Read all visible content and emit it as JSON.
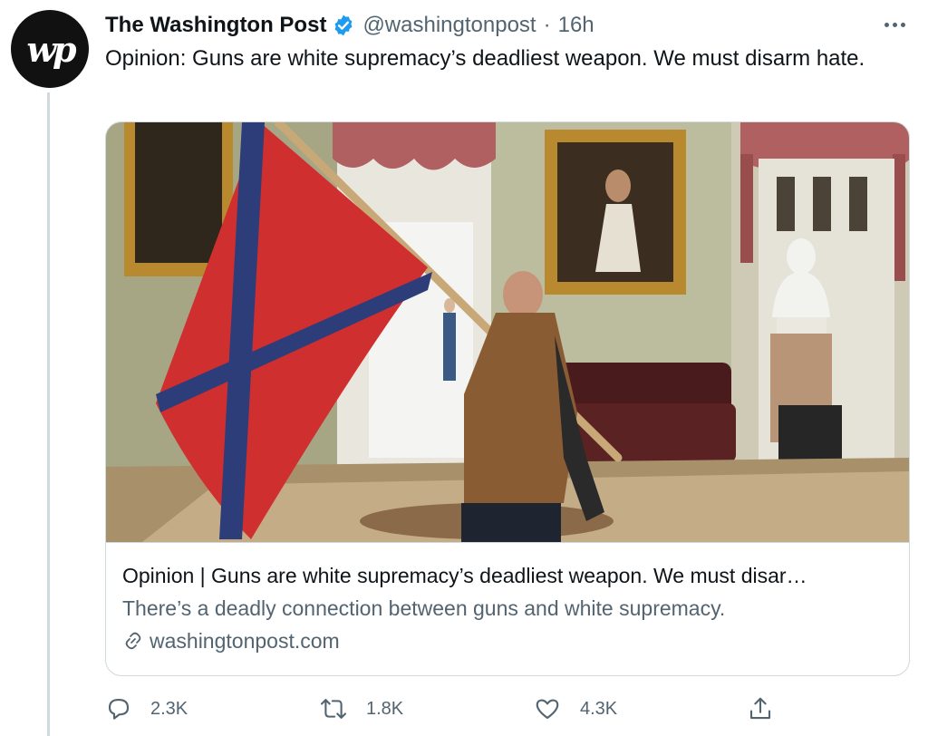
{
  "author": {
    "display_name": "The Washington Post",
    "handle": "@washingtonpost",
    "separator": "·",
    "time": "16h",
    "avatar_text": "wp",
    "verified_color": "#1d9bf0"
  },
  "tweet": {
    "text": "Opinion: Guns are white supremacy’s deadliest weapon. We must disarm hate."
  },
  "card": {
    "title": "Opinion | Guns are white supremacy’s deadliest weapon. We must disar…",
    "description": "There’s a deadly connection between guns and white supremacy.",
    "domain": "washingtonpost.com",
    "link_icon": "link-icon"
  },
  "actions": {
    "replies": "2.3K",
    "retweets": "1.8K",
    "likes": "4.3K",
    "icons": [
      "reply-icon",
      "retweet-icon",
      "like-icon",
      "share-icon"
    ]
  },
  "colors": {
    "text_primary": "#0f1419",
    "text_secondary": "#536471",
    "border": "#cfd9de"
  }
}
